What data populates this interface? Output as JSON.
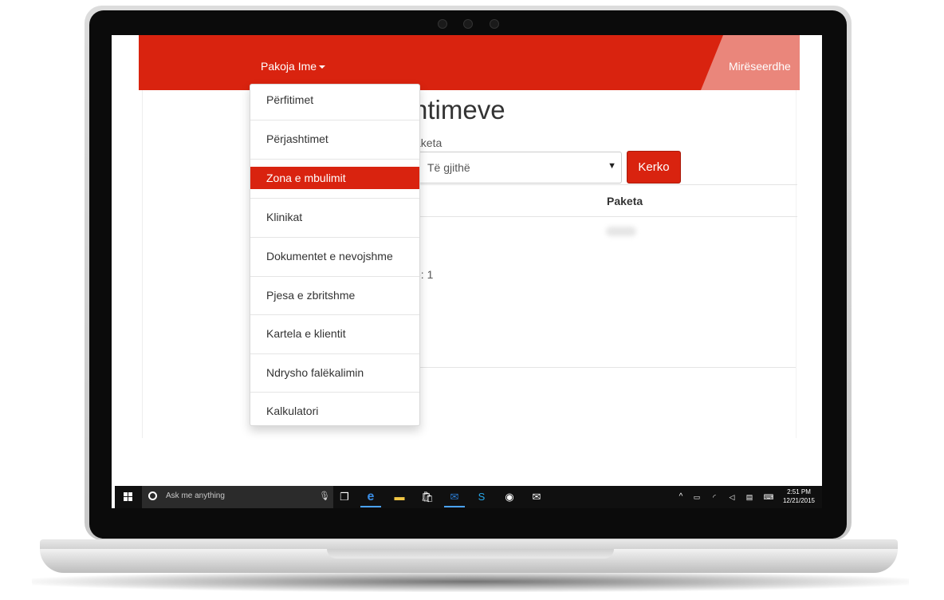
{
  "navbar": {
    "brand_menu_label": "Pakoja Ime",
    "welcome_text": "Mirëseerdhe",
    "accent_color": "#d9230f"
  },
  "main": {
    "page_title_fragment": "ntimeve",
    "filter_label_fragment": "aketa",
    "select_value": "Të gjithë",
    "search_button_label": "Kerko",
    "table": {
      "column_header": "Paketa"
    },
    "count_text_fragment": "e: 1"
  },
  "dropdown": {
    "items": [
      {
        "label": "Përfitimet",
        "active": false
      },
      {
        "label": "Përjashtimet",
        "active": false
      },
      {
        "label": "Zona e mbulimit",
        "active": true
      },
      {
        "label": "Klinikat",
        "active": false
      },
      {
        "label": "Dokumentet e nevojshme",
        "active": false
      },
      {
        "label": "Pjesa e zbritshme",
        "active": false
      },
      {
        "label": "Kartela e klientit",
        "active": false
      },
      {
        "label": "Ndrysho falëkalimin",
        "active": false
      },
      {
        "label": "Kalkulatori",
        "active": false
      }
    ]
  },
  "taskbar": {
    "search_placeholder": "Ask me anything",
    "time": "2:51 PM",
    "date": "12/21/2015",
    "icons": [
      "task-view-icon",
      "edge-icon",
      "file-explorer-icon",
      "store-icon",
      "outlook-icon",
      "skype-icon",
      "media-player-icon",
      "mail-icon"
    ]
  }
}
